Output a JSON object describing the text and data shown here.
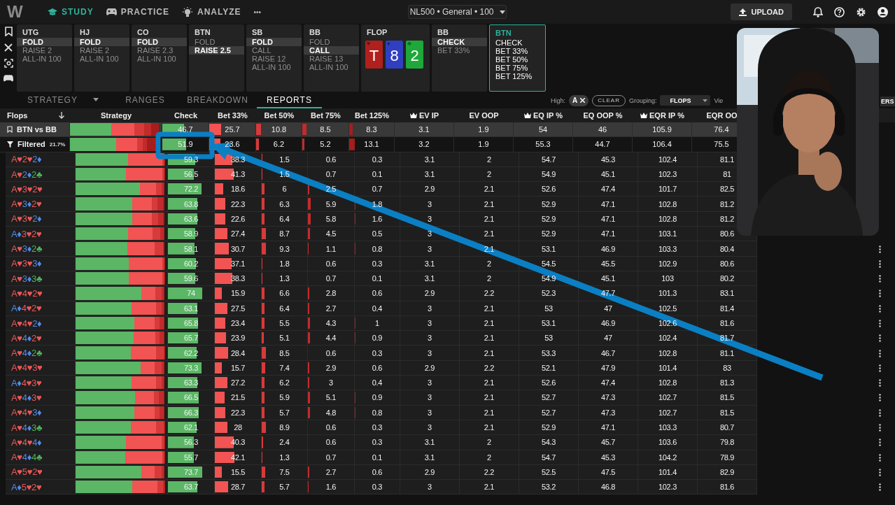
{
  "nav": {
    "logo": "W",
    "items": [
      {
        "label": "STUDY",
        "selected": true
      },
      {
        "label": "PRACTICE",
        "selected": false
      },
      {
        "label": "ANALYZE",
        "selected": false
      }
    ],
    "more": "•••"
  },
  "game_select": {
    "value": "NL500 • General • 100"
  },
  "upload_button": "UPLOAD",
  "line": [
    {
      "kind": "position",
      "title": "UTG",
      "active": false,
      "options": [
        {
          "label": "FOLD",
          "selected": true
        },
        {
          "label": "RAISE 2",
          "selected": false
        },
        {
          "label": "ALL-IN 100",
          "selected": false
        }
      ]
    },
    {
      "kind": "position",
      "title": "HJ",
      "active": false,
      "options": [
        {
          "label": "FOLD",
          "selected": true
        },
        {
          "label": "RAISE 2",
          "selected": false
        },
        {
          "label": "ALL-IN 100",
          "selected": false
        }
      ]
    },
    {
      "kind": "position",
      "title": "CO",
      "active": false,
      "options": [
        {
          "label": "FOLD",
          "selected": true
        },
        {
          "label": "RAISE 2.3",
          "selected": false
        },
        {
          "label": "ALL-IN 100",
          "selected": false
        }
      ]
    },
    {
      "kind": "position",
      "title": "BTN",
      "active": false,
      "options": [
        {
          "label": "FOLD",
          "selected": false
        },
        {
          "label": "RAISE 2.5",
          "selected": true
        }
      ]
    },
    {
      "kind": "position",
      "title": "SB",
      "active": false,
      "options": [
        {
          "label": "FOLD",
          "selected": true
        },
        {
          "label": "CALL",
          "selected": false
        },
        {
          "label": "RAISE 12",
          "selected": false
        },
        {
          "label": "ALL-IN 100",
          "selected": false
        }
      ]
    },
    {
      "kind": "position",
      "title": "BB",
      "active": false,
      "options": [
        {
          "label": "FOLD",
          "selected": false
        },
        {
          "label": "CALL",
          "selected": true
        },
        {
          "label": "RAISE 13",
          "selected": false
        },
        {
          "label": "ALL-IN 100",
          "selected": false
        }
      ]
    },
    {
      "kind": "board",
      "title": "FLOP",
      "cards": [
        {
          "rank": "T",
          "suit": "♥",
          "color": "#b0201c"
        },
        {
          "rank": "8",
          "suit": "♦",
          "color": "#2f3fc0"
        },
        {
          "rank": "2",
          "suit": "♣",
          "color": "#1fa83a"
        }
      ]
    },
    {
      "kind": "position",
      "title": "BB",
      "active": false,
      "options": [
        {
          "label": "CHECK",
          "selected": true
        },
        {
          "label": "BET 33%",
          "selected": false
        }
      ]
    },
    {
      "kind": "position",
      "title": "BTN",
      "active": true,
      "options": [
        {
          "label": "CHECK",
          "selected": false
        },
        {
          "label": "BET 33%",
          "selected": false
        },
        {
          "label": "BET 50%",
          "selected": false
        },
        {
          "label": "BET 75%",
          "selected": false
        },
        {
          "label": "BET 125%",
          "selected": false
        }
      ]
    }
  ],
  "tabs": [
    {
      "label": "STRATEGY",
      "dropdown": true,
      "selected": false
    },
    {
      "label": "RANGES",
      "dropdown": false,
      "selected": false
    },
    {
      "label": "BREAKDOWN",
      "dropdown": false,
      "selected": false
    },
    {
      "label": "REPORTS",
      "dropdown": false,
      "selected": true
    }
  ],
  "filters": {
    "high_label": "High:",
    "high_chip": "A",
    "clear_button": "CLEAR",
    "grouping_label": "Grouping:",
    "grouping": "FLOPS",
    "view_label": "Vie",
    "end_button": "ERS"
  },
  "table": {
    "label_header": "Flops",
    "strategy_header": "Strategy",
    "columns": [
      {
        "label": "Check",
        "crown": false
      },
      {
        "label": "Bet 33%",
        "crown": false
      },
      {
        "label": "Bet 50%",
        "crown": false
      },
      {
        "label": "Bet 75%",
        "crown": false
      },
      {
        "label": "Bet 125%",
        "crown": false
      },
      {
        "label": "EV IP",
        "crown": true
      },
      {
        "label": "EV OOP",
        "crown": false
      },
      {
        "label": "EQ IP %",
        "crown": true
      },
      {
        "label": "EQ OOP %",
        "crown": false
      },
      {
        "label": "EQR IP %",
        "crown": true
      },
      {
        "label": "EQR OO",
        "crown": false
      }
    ],
    "rows": [
      {
        "kind": "summary",
        "label": "BTN vs BB",
        "menu": false,
        "cells": [
          "46.7",
          "25.7",
          "10.8",
          "8.5",
          "8.3",
          "3.1",
          "1.9",
          "54",
          "46",
          "105.9",
          "76.4"
        ]
      },
      {
        "kind": "filtered",
        "label": "Filtered",
        "share": "21.7%",
        "menu": false,
        "cells": [
          "51.9",
          "23.6",
          "6.2",
          "5.2",
          "13.1",
          "3.2",
          "1.9",
          "55.3",
          "44.7",
          "106.4",
          "75.5"
        ]
      },
      {
        "kind": "flop",
        "cards": [
          {
            "text": "A♥",
            "color": "#eb5757"
          },
          {
            "text": "2♥",
            "color": "#eb5757"
          },
          {
            "text": "2♦",
            "color": "#4f8ae6"
          }
        ],
        "menu": false,
        "cells": [
          "59.3",
          "38.3",
          "1.5",
          "0.6",
          "0.3",
          "3.1",
          "2",
          "54.7",
          "45.3",
          "102.4",
          "81.1"
        ]
      },
      {
        "kind": "flop",
        "cards": [
          {
            "text": "A♥",
            "color": "#eb5757"
          },
          {
            "text": "2♦",
            "color": "#4f8ae6"
          },
          {
            "text": "2♣",
            "color": "#4fb55a"
          }
        ],
        "menu": false,
        "cells": [
          "56.5",
          "41.3",
          "1.5",
          "0.7",
          "0.1",
          "3.1",
          "2",
          "54.9",
          "45.1",
          "102.3",
          "81"
        ]
      },
      {
        "kind": "flop",
        "cards": [
          {
            "text": "A♥",
            "color": "#eb5757"
          },
          {
            "text": "3♥",
            "color": "#eb5757"
          },
          {
            "text": "2♥",
            "color": "#eb5757"
          }
        ],
        "menu": false,
        "cells": [
          "72.2",
          "18.6",
          "6",
          "2.5",
          "0.7",
          "2.9",
          "2.1",
          "52.6",
          "47.4",
          "101.7",
          "82.5"
        ]
      },
      {
        "kind": "flop",
        "cards": [
          {
            "text": "A♥",
            "color": "#eb5757"
          },
          {
            "text": "3♦",
            "color": "#4f8ae6"
          },
          {
            "text": "2♥",
            "color": "#eb5757"
          }
        ],
        "menu": false,
        "cells": [
          "63.8",
          "22.3",
          "6.3",
          "5.9",
          "1.8",
          "3",
          "2.1",
          "52.9",
          "47.1",
          "102.8",
          "81.2"
        ]
      },
      {
        "kind": "flop",
        "cards": [
          {
            "text": "A♥",
            "color": "#eb5757"
          },
          {
            "text": "3♥",
            "color": "#eb5757"
          },
          {
            "text": "2♦",
            "color": "#4f8ae6"
          }
        ],
        "menu": false,
        "cells": [
          "63.6",
          "22.6",
          "6.4",
          "5.8",
          "1.6",
          "3",
          "2.1",
          "52.9",
          "47.1",
          "102.8",
          "81.2"
        ]
      },
      {
        "kind": "flop",
        "cards": [
          {
            "text": "A♦",
            "color": "#4f8ae6"
          },
          {
            "text": "3♥",
            "color": "#eb5757"
          },
          {
            "text": "2♥",
            "color": "#eb5757"
          }
        ],
        "menu": false,
        "cells": [
          "58.9",
          "27.4",
          "8.7",
          "4.5",
          "0.5",
          "3",
          "2.1",
          "52.9",
          "47.1",
          "103.1",
          "80.6"
        ]
      },
      {
        "kind": "flop",
        "cards": [
          {
            "text": "A♥",
            "color": "#eb5757"
          },
          {
            "text": "3♦",
            "color": "#4f8ae6"
          },
          {
            "text": "2♣",
            "color": "#4fb55a"
          }
        ],
        "menu": true,
        "cells": [
          "58.1",
          "30.7",
          "9.3",
          "1.1",
          "0.8",
          "3",
          "2.1",
          "53.1",
          "46.9",
          "103.3",
          "80.4"
        ]
      },
      {
        "kind": "flop",
        "cards": [
          {
            "text": "A♥",
            "color": "#eb5757"
          },
          {
            "text": "3♥",
            "color": "#eb5757"
          },
          {
            "text": "3♦",
            "color": "#4f8ae6"
          }
        ],
        "menu": true,
        "cells": [
          "60.2",
          "37.1",
          "1.8",
          "0.6",
          "0.3",
          "3.1",
          "2",
          "54.5",
          "45.5",
          "102.9",
          "80.6"
        ]
      },
      {
        "kind": "flop",
        "cards": [
          {
            "text": "A♥",
            "color": "#eb5757"
          },
          {
            "text": "3♦",
            "color": "#4f8ae6"
          },
          {
            "text": "3♣",
            "color": "#4fb55a"
          }
        ],
        "menu": true,
        "cells": [
          "59.6",
          "38.3",
          "1.3",
          "0.7",
          "0.1",
          "3.1",
          "2",
          "54.9",
          "45.1",
          "103",
          "80.2"
        ]
      },
      {
        "kind": "flop",
        "cards": [
          {
            "text": "A♥",
            "color": "#eb5757"
          },
          {
            "text": "4♥",
            "color": "#eb5757"
          },
          {
            "text": "2♥",
            "color": "#eb5757"
          }
        ],
        "menu": true,
        "cells": [
          "74",
          "15.9",
          "6.6",
          "2.8",
          "0.6",
          "2.9",
          "2.2",
          "52.3",
          "47.7",
          "101.3",
          "83.1"
        ]
      },
      {
        "kind": "flop",
        "cards": [
          {
            "text": "A♦",
            "color": "#4f8ae6"
          },
          {
            "text": "4♥",
            "color": "#eb5757"
          },
          {
            "text": "2♥",
            "color": "#eb5757"
          }
        ],
        "menu": true,
        "cells": [
          "63.1",
          "27.5",
          "6.4",
          "2.7",
          "0.4",
          "3",
          "2.1",
          "53",
          "47",
          "102.5",
          "81.4"
        ]
      },
      {
        "kind": "flop",
        "cards": [
          {
            "text": "A♥",
            "color": "#eb5757"
          },
          {
            "text": "4♥",
            "color": "#eb5757"
          },
          {
            "text": "2♦",
            "color": "#4f8ae6"
          }
        ],
        "menu": true,
        "cells": [
          "65.8",
          "23.4",
          "5.5",
          "4.3",
          "1",
          "3",
          "2.1",
          "53.1",
          "46.9",
          "102.6",
          "81.6"
        ]
      },
      {
        "kind": "flop",
        "cards": [
          {
            "text": "A♥",
            "color": "#eb5757"
          },
          {
            "text": "4♦",
            "color": "#4f8ae6"
          },
          {
            "text": "2♥",
            "color": "#eb5757"
          }
        ],
        "menu": true,
        "cells": [
          "65.7",
          "23.9",
          "5.1",
          "4.4",
          "0.9",
          "3",
          "2.1",
          "53",
          "47",
          "102.4",
          "81.7"
        ]
      },
      {
        "kind": "flop",
        "cards": [
          {
            "text": "A♥",
            "color": "#eb5757"
          },
          {
            "text": "4♦",
            "color": "#4f8ae6"
          },
          {
            "text": "2♣",
            "color": "#4fb55a"
          }
        ],
        "menu": true,
        "cells": [
          "62.2",
          "28.4",
          "8.5",
          "0.6",
          "0.3",
          "3",
          "2.1",
          "53.3",
          "46.7",
          "102.8",
          "81.1"
        ]
      },
      {
        "kind": "flop",
        "cards": [
          {
            "text": "A♥",
            "color": "#eb5757"
          },
          {
            "text": "4♥",
            "color": "#eb5757"
          },
          {
            "text": "3♥",
            "color": "#eb5757"
          }
        ],
        "menu": true,
        "cells": [
          "73.3",
          "15.7",
          "7.4",
          "2.9",
          "0.6",
          "2.9",
          "2.2",
          "52.1",
          "47.9",
          "101.4",
          "83"
        ]
      },
      {
        "kind": "flop",
        "cards": [
          {
            "text": "A♦",
            "color": "#4f8ae6"
          },
          {
            "text": "4♥",
            "color": "#eb5757"
          },
          {
            "text": "3♥",
            "color": "#eb5757"
          }
        ],
        "menu": true,
        "cells": [
          "63.3",
          "27.2",
          "6.2",
          "3",
          "0.4",
          "3",
          "2.1",
          "52.6",
          "47.4",
          "102.8",
          "81.3"
        ]
      },
      {
        "kind": "flop",
        "cards": [
          {
            "text": "A♥",
            "color": "#eb5757"
          },
          {
            "text": "4♦",
            "color": "#4f8ae6"
          },
          {
            "text": "3♥",
            "color": "#eb5757"
          }
        ],
        "menu": true,
        "cells": [
          "66.5",
          "21.5",
          "5.9",
          "5.1",
          "0.9",
          "3",
          "2.1",
          "52.7",
          "47.3",
          "102.7",
          "81.5"
        ]
      },
      {
        "kind": "flop",
        "cards": [
          {
            "text": "A♥",
            "color": "#eb5757"
          },
          {
            "text": "4♥",
            "color": "#eb5757"
          },
          {
            "text": "3♦",
            "color": "#4f8ae6"
          }
        ],
        "menu": true,
        "cells": [
          "66.3",
          "22.3",
          "5.7",
          "4.8",
          "0.8",
          "3",
          "2.1",
          "52.7",
          "47.3",
          "102.7",
          "81.5"
        ]
      },
      {
        "kind": "flop",
        "cards": [
          {
            "text": "A♥",
            "color": "#eb5757"
          },
          {
            "text": "4♦",
            "color": "#4f8ae6"
          },
          {
            "text": "3♣",
            "color": "#4fb55a"
          }
        ],
        "menu": true,
        "cells": [
          "62.1",
          "28",
          "8.9",
          "0.6",
          "0.3",
          "3",
          "2.1",
          "52.9",
          "47.1",
          "103.3",
          "80.7"
        ]
      },
      {
        "kind": "flop",
        "cards": [
          {
            "text": "A♥",
            "color": "#eb5757"
          },
          {
            "text": "4♥",
            "color": "#eb5757"
          },
          {
            "text": "4♦",
            "color": "#4f8ae6"
          }
        ],
        "menu": true,
        "cells": [
          "56.3",
          "40.3",
          "2.4",
          "0.6",
          "0.3",
          "3.1",
          "2",
          "54.3",
          "45.7",
          "103.6",
          "79.8"
        ]
      },
      {
        "kind": "flop",
        "cards": [
          {
            "text": "A♥",
            "color": "#eb5757"
          },
          {
            "text": "4♦",
            "color": "#4f8ae6"
          },
          {
            "text": "4♣",
            "color": "#4fb55a"
          }
        ],
        "menu": true,
        "cells": [
          "55.7",
          "42.1",
          "1.3",
          "0.7",
          "0.1",
          "3.1",
          "2",
          "54.7",
          "45.3",
          "104.2",
          "78.9"
        ]
      },
      {
        "kind": "flop",
        "cards": [
          {
            "text": "A♥",
            "color": "#eb5757"
          },
          {
            "text": "5♥",
            "color": "#eb5757"
          },
          {
            "text": "2♥",
            "color": "#eb5757"
          }
        ],
        "menu": true,
        "cells": [
          "73.7",
          "15.5",
          "7.5",
          "2.7",
          "0.6",
          "2.9",
          "2.2",
          "52.5",
          "47.5",
          "101.4",
          "82.9"
        ]
      },
      {
        "kind": "flop",
        "cards": [
          {
            "text": "A♦",
            "color": "#4f8ae6"
          },
          {
            "text": "5♥",
            "color": "#eb5757"
          },
          {
            "text": "2♥",
            "color": "#eb5757"
          }
        ],
        "menu": true,
        "cells": [
          "63.7",
          "28.7",
          "5.7",
          "1.6",
          "0.3",
          "3",
          "2.1",
          "53.2",
          "46.8",
          "102.3",
          "81.6"
        ]
      }
    ]
  }
}
